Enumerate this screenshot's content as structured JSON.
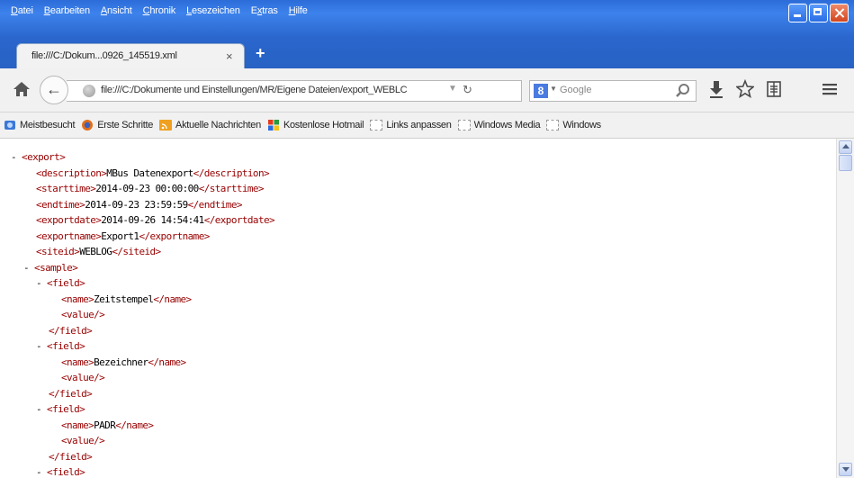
{
  "menu": {
    "items": [
      "Datei",
      "Bearbeiten",
      "Ansicht",
      "Chronik",
      "Lesezeichen",
      "Extras",
      "Hilfe"
    ]
  },
  "tab": {
    "title": "file:///C:/Dokum...0926_145519.xml",
    "close": "×",
    "new_tab": "+"
  },
  "navbar": {
    "url": "file:///C:/Dokumente und Einstellungen/MR/Eigene Dateien/export_WEBLC",
    "search_placeholder": "Google",
    "search_engine_letter": "8"
  },
  "bookmarks": [
    {
      "label": "Meistbesucht",
      "icon": "meistbesucht-icon",
      "color": "#3a78d8"
    },
    {
      "label": "Erste Schritte",
      "icon": "firefox-icon",
      "color": "#e0701a"
    },
    {
      "label": "Aktuelle Nachrichten",
      "icon": "rss-icon",
      "color": "#f0a020"
    },
    {
      "label": "Kostenlose Hotmail",
      "icon": "windows-flag-icon",
      "color": "#2a9a3a"
    },
    {
      "label": "Links anpassen",
      "icon": "page-icon",
      "color": "#999999"
    },
    {
      "label": "Windows Media",
      "icon": "page-icon",
      "color": "#999999"
    },
    {
      "label": "Windows",
      "icon": "page-icon",
      "color": "#999999"
    }
  ],
  "xml_lines": [
    {
      "indent": 0,
      "dash": "- ",
      "open": "<export>",
      "text": "",
      "close": ""
    },
    {
      "indent": 1,
      "dash": "",
      "open": "<description>",
      "text": "MBus Datenexport",
      "close": "</description>"
    },
    {
      "indent": 1,
      "dash": "",
      "open": "<starttime>",
      "text": "2014-09-23 00:00:00",
      "close": "</starttime>"
    },
    {
      "indent": 1,
      "dash": "",
      "open": "<endtime>",
      "text": "2014-09-23 23:59:59",
      "close": "</endtime>"
    },
    {
      "indent": 1,
      "dash": "",
      "open": "<exportdate>",
      "text": "2014-09-26 14:54:41",
      "close": "</exportdate>"
    },
    {
      "indent": 1,
      "dash": "",
      "open": "<exportname>",
      "text": "Export1",
      "close": "</exportname>"
    },
    {
      "indent": 1,
      "dash": "",
      "open": "<siteid>",
      "text": "WEBLOG",
      "close": "</siteid>"
    },
    {
      "indent": 1,
      "dash": "- ",
      "open": "<sample>",
      "text": "",
      "close": ""
    },
    {
      "indent": 2,
      "dash": "- ",
      "open": "<field>",
      "text": "",
      "close": ""
    },
    {
      "indent": 3,
      "dash": "",
      "open": "<name>",
      "text": "Zeitstempel",
      "close": "</name>"
    },
    {
      "indent": 3,
      "dash": "",
      "open": "<value/>",
      "text": "",
      "close": ""
    },
    {
      "indent": 2,
      "dash": "",
      "open": "</field>",
      "text": "",
      "close": ""
    },
    {
      "indent": 2,
      "dash": "- ",
      "open": "<field>",
      "text": "",
      "close": ""
    },
    {
      "indent": 3,
      "dash": "",
      "open": "<name>",
      "text": "Bezeichner",
      "close": "</name>"
    },
    {
      "indent": 3,
      "dash": "",
      "open": "<value/>",
      "text": "",
      "close": ""
    },
    {
      "indent": 2,
      "dash": "",
      "open": "</field>",
      "text": "",
      "close": ""
    },
    {
      "indent": 2,
      "dash": "- ",
      "open": "<field>",
      "text": "",
      "close": ""
    },
    {
      "indent": 3,
      "dash": "",
      "open": "<name>",
      "text": "PADR",
      "close": "</name>"
    },
    {
      "indent": 3,
      "dash": "",
      "open": "<value/>",
      "text": "",
      "close": ""
    },
    {
      "indent": 2,
      "dash": "",
      "open": "</field>",
      "text": "",
      "close": ""
    },
    {
      "indent": 2,
      "dash": "- ",
      "open": "<field>",
      "text": "",
      "close": ""
    }
  ],
  "colors": {
    "tag": "#990000",
    "titlebar": "#2c6cd8"
  }
}
